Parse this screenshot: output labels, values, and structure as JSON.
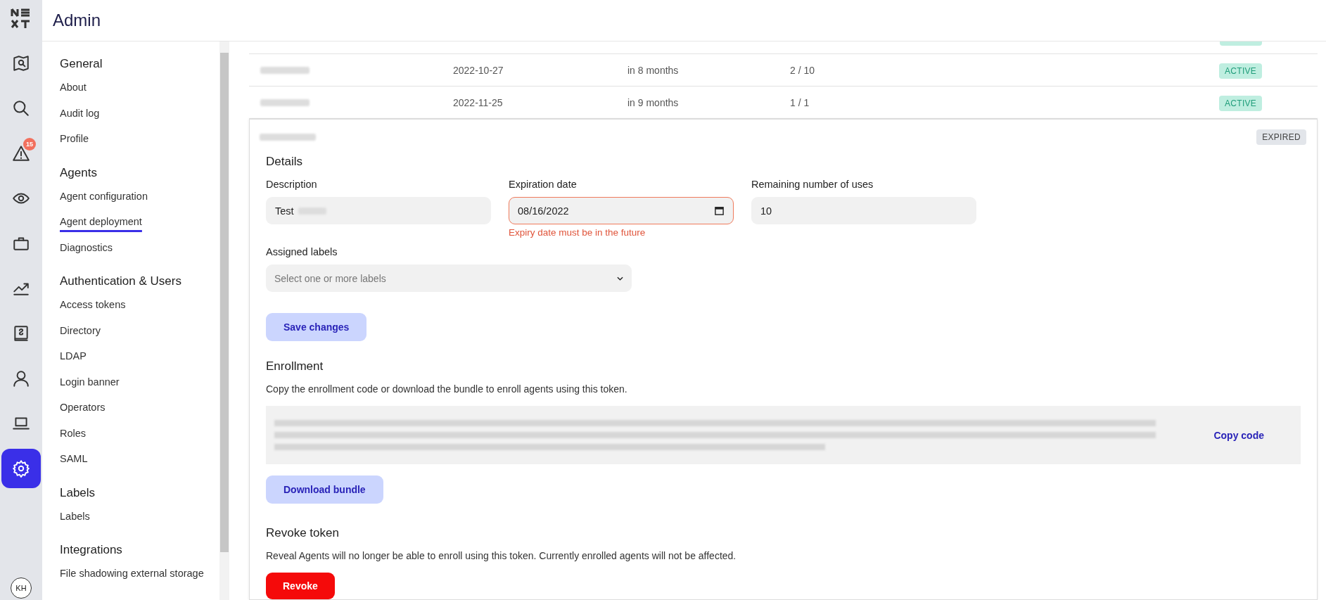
{
  "rail": {
    "items": [
      {
        "kind": "map",
        "selected": false
      },
      {
        "kind": "search",
        "selected": false
      },
      {
        "kind": "alert",
        "selected": false,
        "badge": "15"
      },
      {
        "kind": "eye",
        "selected": false
      },
      {
        "kind": "briefcase",
        "selected": false
      },
      {
        "kind": "chart",
        "selected": false
      },
      {
        "kind": "book",
        "selected": false
      },
      {
        "kind": "user",
        "selected": false
      },
      {
        "kind": "laptop",
        "selected": false
      },
      {
        "kind": "settings",
        "selected": true
      }
    ],
    "avatar": "KH"
  },
  "header": {
    "title": "Admin"
  },
  "sidebar": {
    "sections": [
      {
        "title": "General",
        "items": [
          {
            "label": "About",
            "selected": false
          },
          {
            "label": "Audit log",
            "selected": false
          },
          {
            "label": "Profile",
            "selected": false
          }
        ]
      },
      {
        "title": "Agents",
        "items": [
          {
            "label": "Agent configuration",
            "selected": false
          },
          {
            "label": "Agent deployment",
            "selected": true
          },
          {
            "label": "Diagnostics",
            "selected": false
          }
        ]
      },
      {
        "title": "Authentication & Users",
        "items": [
          {
            "label": "Access tokens",
            "selected": false
          },
          {
            "label": "Directory",
            "selected": false
          },
          {
            "label": "LDAP",
            "selected": false
          },
          {
            "label": "Login banner",
            "selected": false
          },
          {
            "label": "Operators",
            "selected": false
          },
          {
            "label": "Roles",
            "selected": false
          },
          {
            "label": "SAML",
            "selected": false
          }
        ]
      },
      {
        "title": "Labels",
        "items": [
          {
            "label": "Labels",
            "selected": false
          }
        ]
      },
      {
        "title": "Integrations",
        "items": [
          {
            "label": "File shadowing external storage",
            "selected": false
          }
        ]
      }
    ]
  },
  "tokens": {
    "rows": [
      {
        "created": "2022-10-27",
        "expires": "in 8 months",
        "uses": "2 / 10",
        "status": "ACTIVE"
      },
      {
        "created": "2022-11-25",
        "expires": "in 9 months",
        "uses": "1 / 1",
        "status": "ACTIVE"
      }
    ],
    "expanded": {
      "status": "EXPIRED",
      "details": {
        "title": "Details",
        "fields": [
          {
            "label": "Description",
            "value": "Test",
            "kind": "text"
          },
          {
            "label": "Expiration date",
            "value": "08/16/2022",
            "kind": "date",
            "error": "Expiry date must be in the future"
          },
          {
            "label": "Remaining number of uses",
            "value": "10",
            "kind": "text"
          }
        ],
        "labels": {
          "label": "Assigned labels",
          "placeholder": "Select one or more labels"
        },
        "save": "Save changes"
      },
      "enrollment": {
        "title": "Enrollment",
        "description": "Copy the enrollment code or download the bundle to enroll agents using this token.",
        "copy": "Copy code",
        "download": "Download bundle"
      },
      "revoke": {
        "title": "Revoke token",
        "description": "Reveal Agents will no longer be able to enroll using this token. Currently enrolled agents will not be affected.",
        "button": "Revoke"
      }
    }
  }
}
